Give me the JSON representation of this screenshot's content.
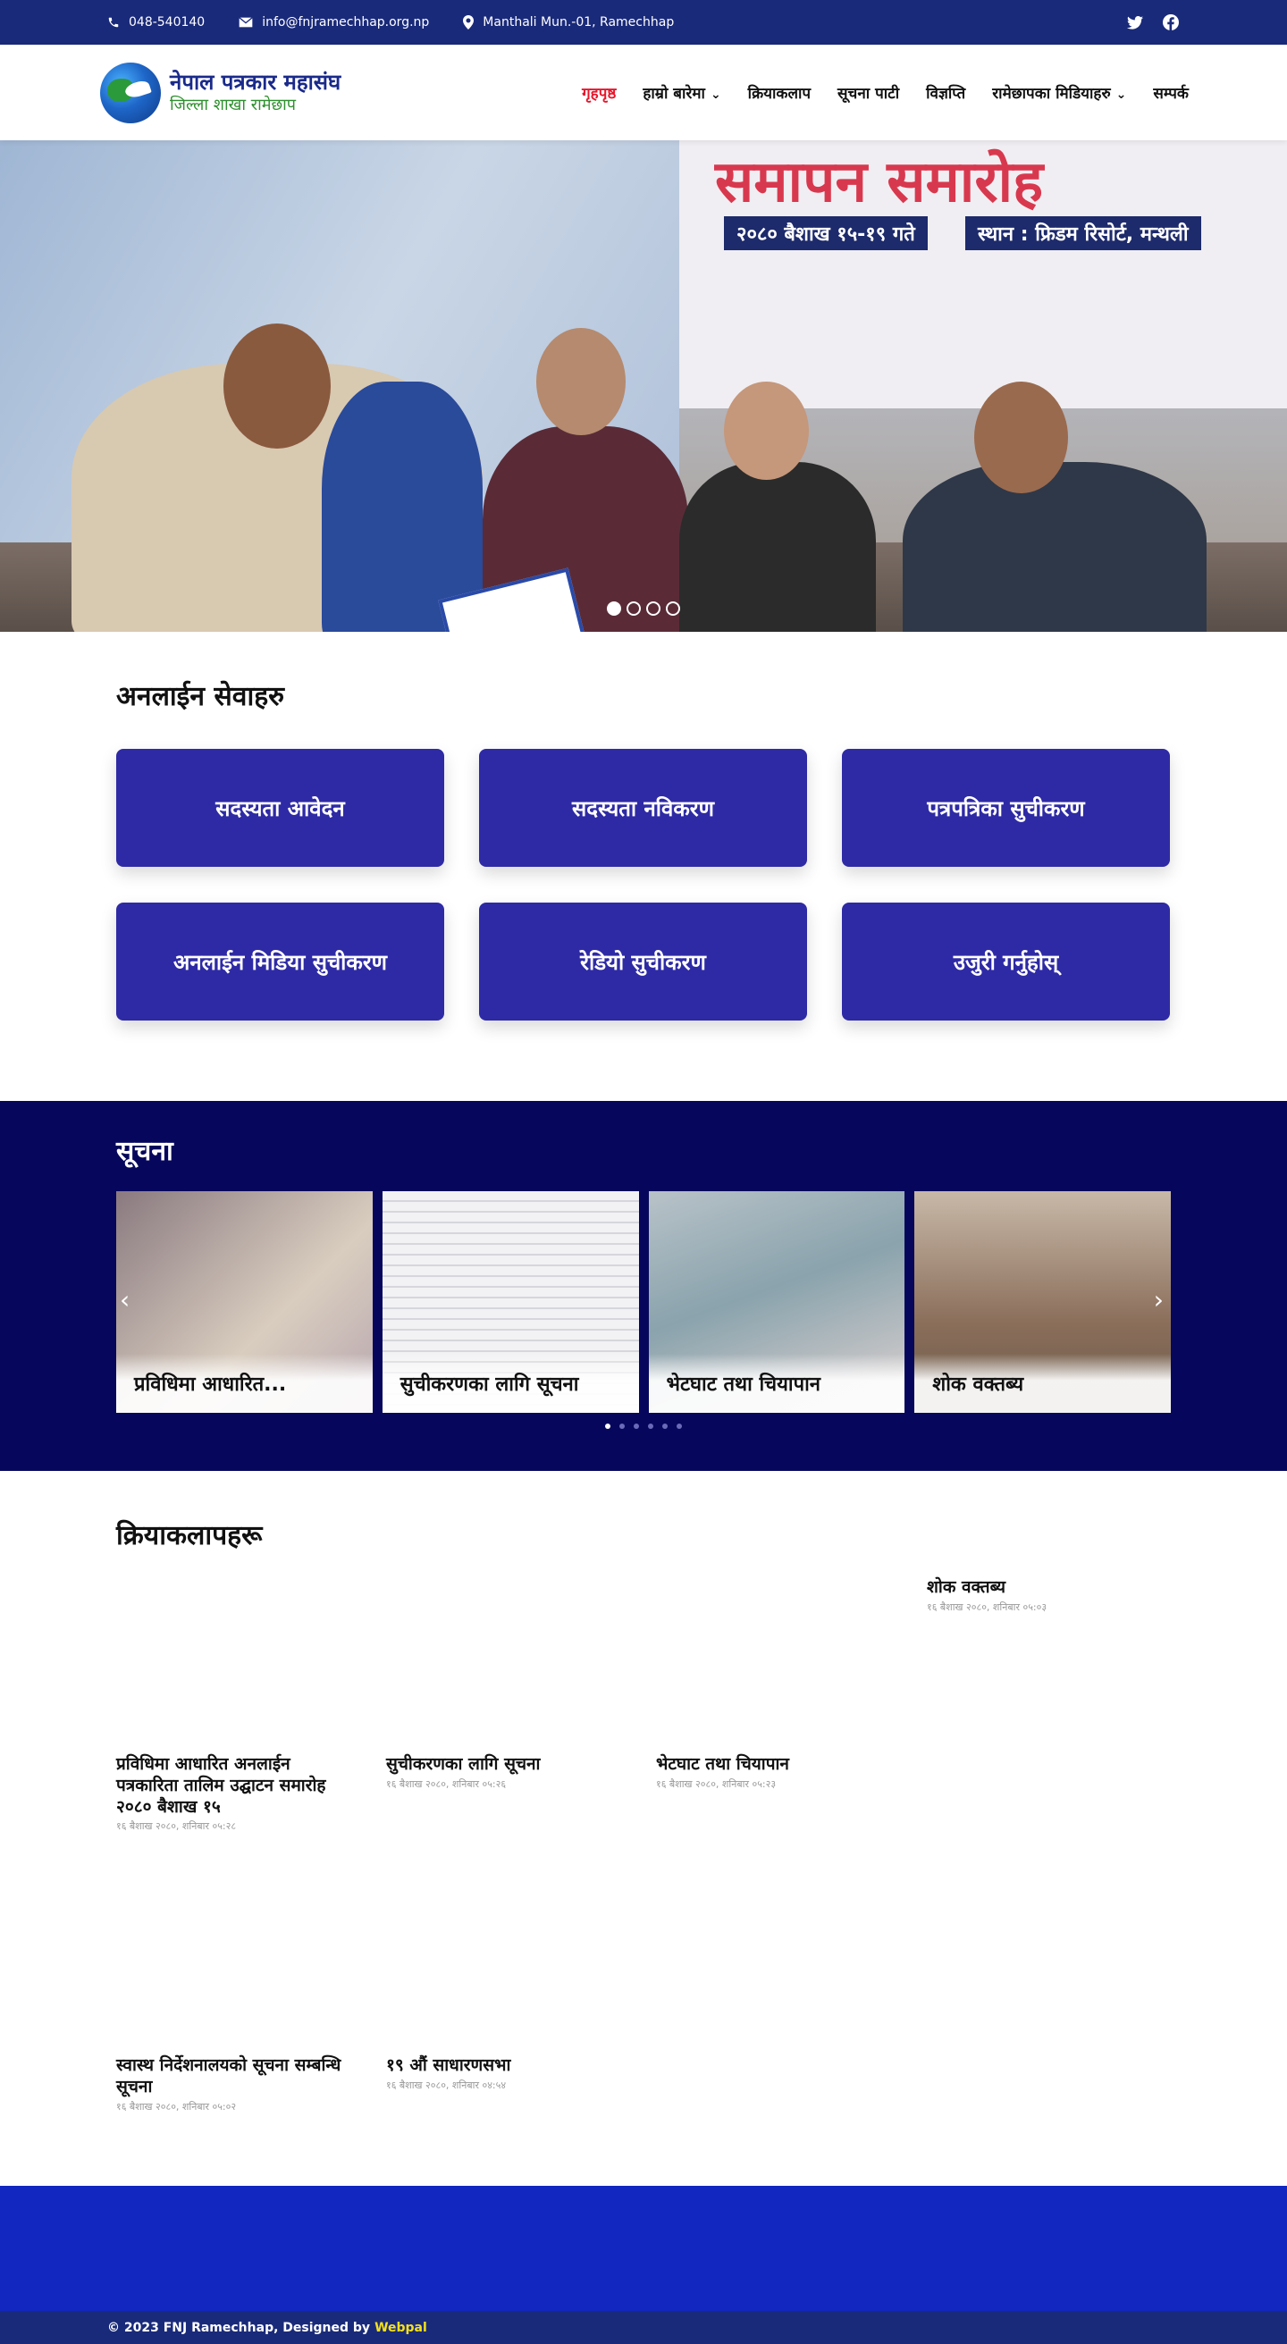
{
  "topbar": {
    "phone": "048-540140",
    "email": "info@fnjramechhap.org.np",
    "address": "Manthali Mun.-01, Ramechhap",
    "social": [
      "twitter-icon",
      "facebook-icon"
    ]
  },
  "logo": {
    "title": "नेपाल पत्रकार महासंघ",
    "subtitle": "जिल्ला शाखा रामेछाप"
  },
  "nav": [
    {
      "label": "गृहपृष्ठ",
      "active": true
    },
    {
      "label": "हाम्रो बारेमा",
      "dropdown": true
    },
    {
      "label": "क्रियाकलाप"
    },
    {
      "label": "सूचना पाटी"
    },
    {
      "label": "विज्ञप्ति"
    },
    {
      "label": "रामेछापका मिडियाहरु",
      "dropdown": true
    },
    {
      "label": "सम्पर्क"
    }
  ],
  "hero": {
    "banner_title": "समापन समारोह",
    "banner_date": "२०८० बैशाख १५-१९ गते",
    "banner_venue": "स्थान : फ्रिडम रिसोर्ट, मन्थली",
    "slides": 4,
    "active_slide": 1
  },
  "services": {
    "title": "अनलाईन सेवाहरु",
    "items": [
      "सदस्यता आवेदन",
      "सदस्यता नविकरण",
      "पत्रपत्रिका सुचीकरण",
      "अनलाईन मिडिया सुचीकरण",
      "रेडियो सुचीकरण",
      "उजुरी गर्नुहोस्"
    ]
  },
  "notices": {
    "title": "सूचना",
    "cards": [
      "प्रविधिमा आधारित...",
      "सुचीकरणका लागि सूचना",
      "भेटघाट तथा चियापान",
      "शोक वक्तब्य"
    ],
    "pages": 6,
    "active_page": 1
  },
  "activities": {
    "title": "क्रियाकलापहरू",
    "items": [
      {
        "title": "शोक वक्तब्य",
        "date": "१६ बैशाख २०८०, शनिबार ०५:०३"
      },
      {
        "title": "प्रविधिमा आधारित अनलाईन पत्रकारिता तालिम उद्घाटन समारोह २०८० बैशाख १५",
        "date": "१६ बैशाख २०८०, शनिबार ०५:२८"
      },
      {
        "title": "सुचीकरणका लागि सूचना",
        "date": "१६ बैशाख २०८०, शनिबार ०५:२६"
      },
      {
        "title": "भेटघाट तथा चियापान",
        "date": "१६ बैशाख २०८०, शनिबार ०५:२३"
      },
      {
        "title": "स्वास्थ निर्देशनालयको सूचना सम्बन्धि सूचना",
        "date": "१६ बैशाख २०८०, शनिबार ०५:०२"
      },
      {
        "title": "१९ औं साधारणसभा",
        "date": "१६ बैशाख २०८०, शनिबार ०४:५४"
      }
    ]
  },
  "footer": {
    "copyright": "© 2023 FNJ Ramechhap, Designed by",
    "brand": "Webpal"
  }
}
